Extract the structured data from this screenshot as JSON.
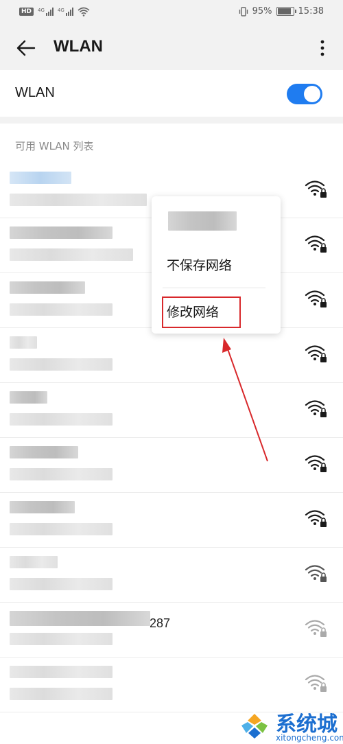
{
  "status_bar": {
    "hd_badge": "HD",
    "signal_labels": [
      "4G",
      "4G"
    ],
    "battery_percent": "95%",
    "battery_level": 0.95,
    "time": "15:38"
  },
  "app_bar": {
    "title": "WLAN",
    "back_icon": "arrow-left-icon",
    "more_icon": "more-vertical-icon"
  },
  "wlan_toggle": {
    "label": "WLAN",
    "enabled": true,
    "accent_color": "#1f7cf0"
  },
  "network_list": {
    "section_title": "可用 WLAN 列表",
    "networks": [
      {
        "name_visible": "",
        "status": "",
        "secured": true,
        "signal": "strong"
      },
      {
        "name_visible": "",
        "status": "",
        "secured": true,
        "signal": "strong"
      },
      {
        "name_visible": "",
        "status": "",
        "secured": true,
        "signal": "strong"
      },
      {
        "name_visible": "",
        "status": "",
        "secured": true,
        "signal": "strong"
      },
      {
        "name_visible": "",
        "status": "",
        "secured": true,
        "signal": "strong"
      },
      {
        "name_visible": "",
        "status": "",
        "secured": true,
        "signal": "strong"
      },
      {
        "name_visible": "",
        "status": "",
        "secured": true,
        "signal": "strong"
      },
      {
        "name_visible": "",
        "status": "",
        "secured": true,
        "signal": "medium"
      },
      {
        "name_visible": "287",
        "status": "",
        "secured": true,
        "signal": "weak"
      },
      {
        "name_visible": "",
        "status": "",
        "secured": true,
        "signal": "weak"
      }
    ]
  },
  "context_menu": {
    "items": [
      "不保存网络",
      "修改网络"
    ],
    "highlighted_item": "修改网络",
    "highlight_color": "#d8282b"
  },
  "watermark": {
    "text": "系统城",
    "sub": "xitongcheng.com"
  }
}
